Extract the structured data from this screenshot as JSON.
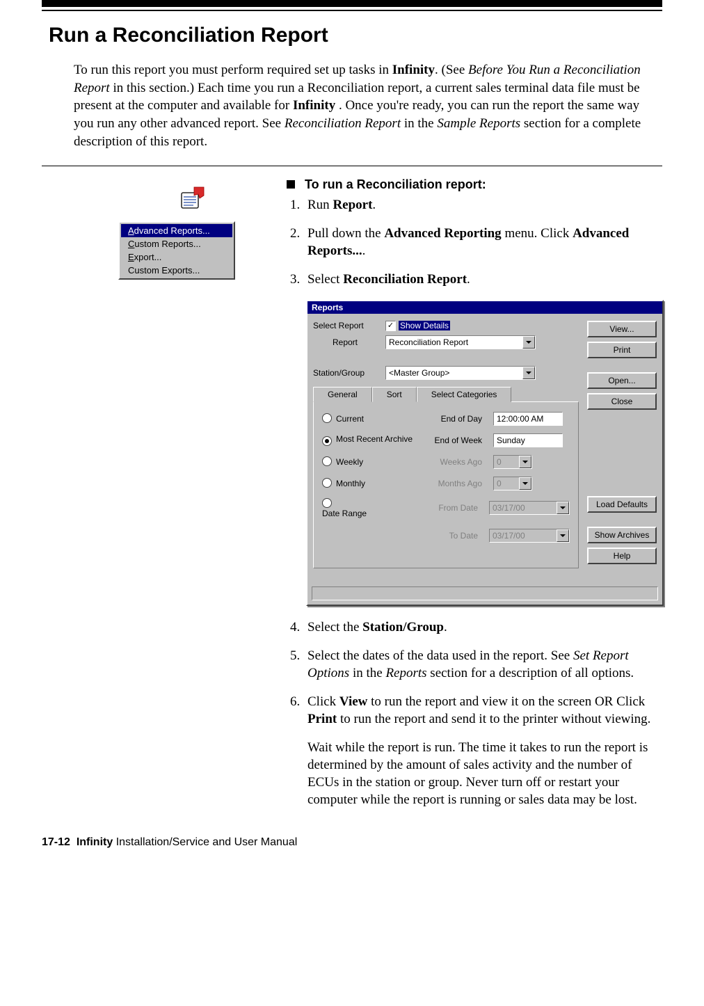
{
  "page": {
    "title": "Run a Reconciliation Report",
    "intro_html": "To run this report you must perform required set up tasks in <b>Infinity</b>. (See <i>Before You Run a Reconciliation Report</i> in this section.) Each time you run a Reconciliation report, a current sales terminal data file must be present at the computer and available for <b>Infinity</b> . Once you're ready, you can run the report the same way you run any other advanced report. See <i>Reconciliation Report</i> in the <i>Sample Reports</i> section for a complete description of this report.",
    "proc_header": "To run a Reconciliation report:",
    "footer_page": "17-12",
    "footer_product": "Infinity",
    "footer_rest": " Installation/Service and User Manual"
  },
  "context_menu": {
    "items": [
      {
        "label_pre": "",
        "accel": "A",
        "label_post": "dvanced Reports...",
        "selected": true
      },
      {
        "label_pre": "",
        "accel": "C",
        "label_post": "ustom Reports...",
        "selected": false
      },
      {
        "label_pre": "",
        "accel": "E",
        "label_post": "xport...",
        "selected": false
      },
      {
        "label_pre": "Custom Exports...",
        "accel": "",
        "label_post": "",
        "selected": false
      }
    ]
  },
  "steps": {
    "s1": "Run <b>Report</b>.",
    "s2": "Pull down the <b>Advanced Reporting</b> menu. Click <b>Advanced Reports...</b>.",
    "s3": "Select <b>Reconciliation Report</b>.",
    "s4": "Select the <b>Station/Group</b>.",
    "s5": "Select the dates of the data used in the report. See <i>Set Report Options</i> in the <i>Reports</i> section for a description of all options.",
    "s6": "Click <b>View</b> to run the report and view it on the screen OR Click <b>Print</b> to run the report and send it to the printer without viewing.",
    "note": "Wait while the report is run. The time it takes to run the report is determined by the amount of sales activity and the number of ECUs in the station or group. Never turn off or restart your computer while the report is running or sales data may be lost."
  },
  "dialog": {
    "title": "Reports",
    "labels": {
      "select_report": "Select Report",
      "report": "Report",
      "show_details": "Show Details",
      "station_group": "Station/Group"
    },
    "report_combo": "Reconciliation Report",
    "station_combo": "<Master Group>",
    "tabs": {
      "general": "General",
      "sort": "Sort",
      "select_categories": "Select Categories"
    },
    "radios": {
      "current": "Current",
      "most_recent": "Most Recent Archive",
      "weekly": "Weekly",
      "monthly": "Monthly",
      "date_range": "Date Range"
    },
    "field_labels": {
      "end_of_day": "End of Day",
      "end_of_week": "End of Week",
      "weeks_ago": "Weeks Ago",
      "months_ago": "Months Ago",
      "from_date": "From Date",
      "to_date": "To Date"
    },
    "field_values": {
      "end_of_day": "12:00:00 AM",
      "end_of_week": "Sunday",
      "weeks_ago": "0",
      "months_ago": "0",
      "from_date": "03/17/00",
      "to_date": "03/17/00"
    },
    "buttons": {
      "view": "View...",
      "print": "Print",
      "open": "Open...",
      "close": "Close",
      "load_defaults": "Load Defaults",
      "show_archives": "Show Archives",
      "help": "Help"
    }
  }
}
